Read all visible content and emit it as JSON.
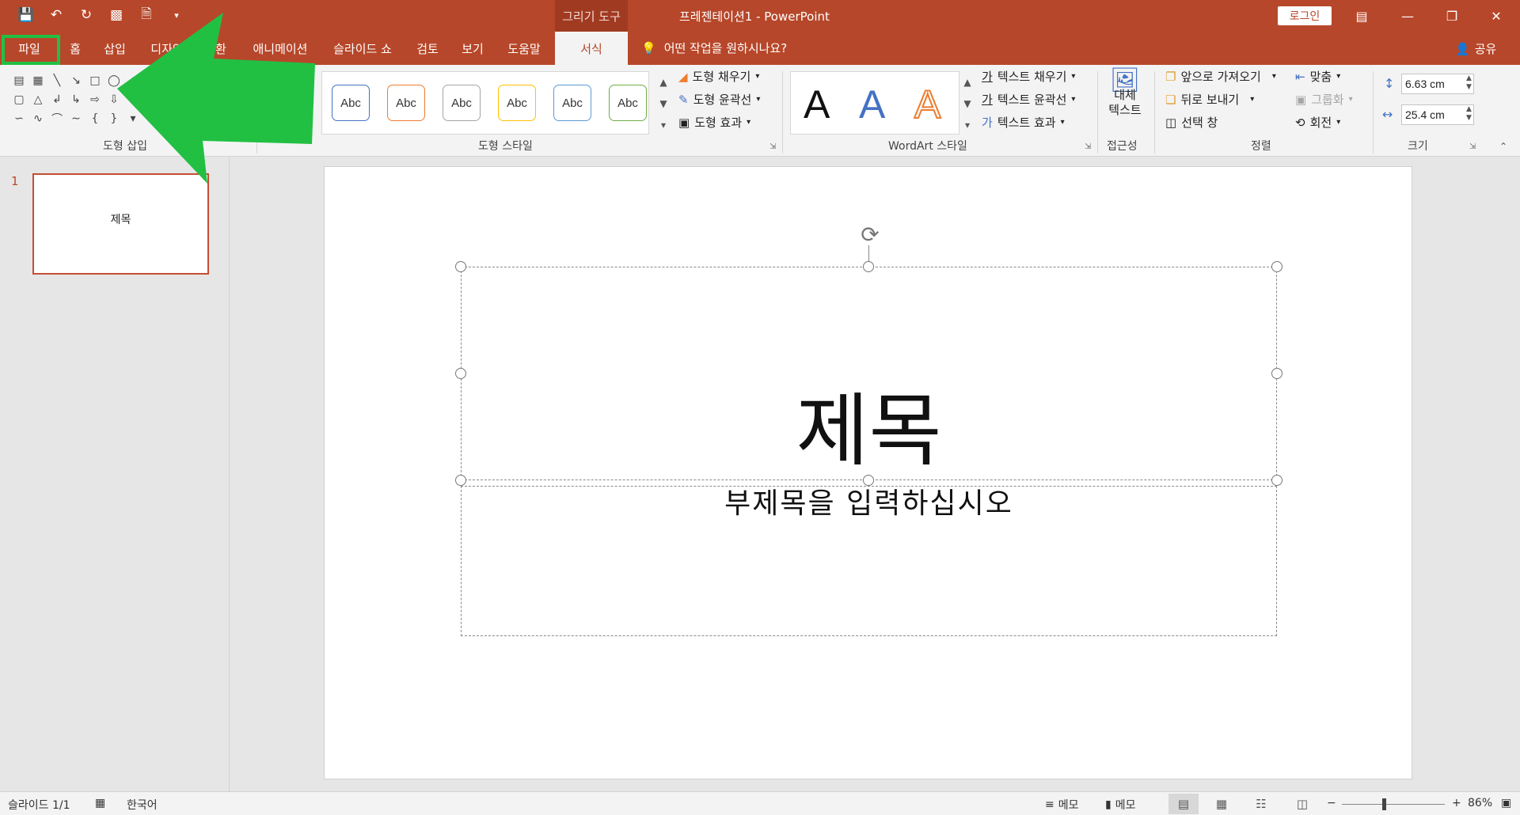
{
  "titlebar": {
    "context_group": "그리기 도구",
    "doc_title": "프레젠테이션1  -  PowerPoint",
    "login": "로그인",
    "bg": "#b7472a"
  },
  "tabs": [
    {
      "label": "파일"
    },
    {
      "label": "홈"
    },
    {
      "label": "삽입"
    },
    {
      "label": "디자인"
    },
    {
      "label": "전환"
    },
    {
      "label": "애니메이션"
    },
    {
      "label": "슬라이드 쇼"
    },
    {
      "label": "검토"
    },
    {
      "label": "보기"
    },
    {
      "label": "도움말"
    },
    {
      "label": "서식"
    }
  ],
  "tell_me": "어떤 작업을 원하시나요?",
  "share": "공유",
  "ribbon": {
    "groups": {
      "insert_shapes": "도형 삽입",
      "shape_styles": "도형 스타일",
      "wordart_styles": "WordArt 스타일",
      "accessibility": "접근성",
      "arrange": "정렬",
      "size": "크기"
    },
    "style_samples": [
      "Abc",
      "Abc",
      "Abc",
      "Abc",
      "Abc",
      "Abc"
    ],
    "shape_fill": "도형 채우기",
    "shape_outline": "도형 윤곽선",
    "shape_effects": "도형 효과",
    "wordart_letter": "A",
    "text_fill": "텍스트 채우기",
    "text_outline": "텍스트 윤곽선",
    "text_effects": "텍스트 효과",
    "alt_text_line1": "대체",
    "alt_text_line2": "텍스트",
    "bring_forward": "앞으로 가져오기",
    "send_backward": "뒤로 보내기",
    "selection_pane": "선택 창",
    "align": "맞춤",
    "group": "그룹화",
    "rotate": "회전",
    "height": "6.63 cm",
    "width": "25.4 cm"
  },
  "thumbnail": {
    "number": "1",
    "title": "제목"
  },
  "slide": {
    "title": "제목",
    "subtitle": "부제목을 입력하십시오"
  },
  "statusbar": {
    "slide_count": "슬라이드 1/1",
    "language": "한국어",
    "notes": "메모",
    "comments": "메모",
    "zoom": "86%"
  },
  "colors": {
    "accent": "#b7472a",
    "highlight_arrow": "#21c043"
  },
  "icons": {
    "qat": [
      "save-icon",
      "undo-icon",
      "redo-icon",
      "present-icon",
      "new-file-icon",
      "customize-icon"
    ]
  }
}
